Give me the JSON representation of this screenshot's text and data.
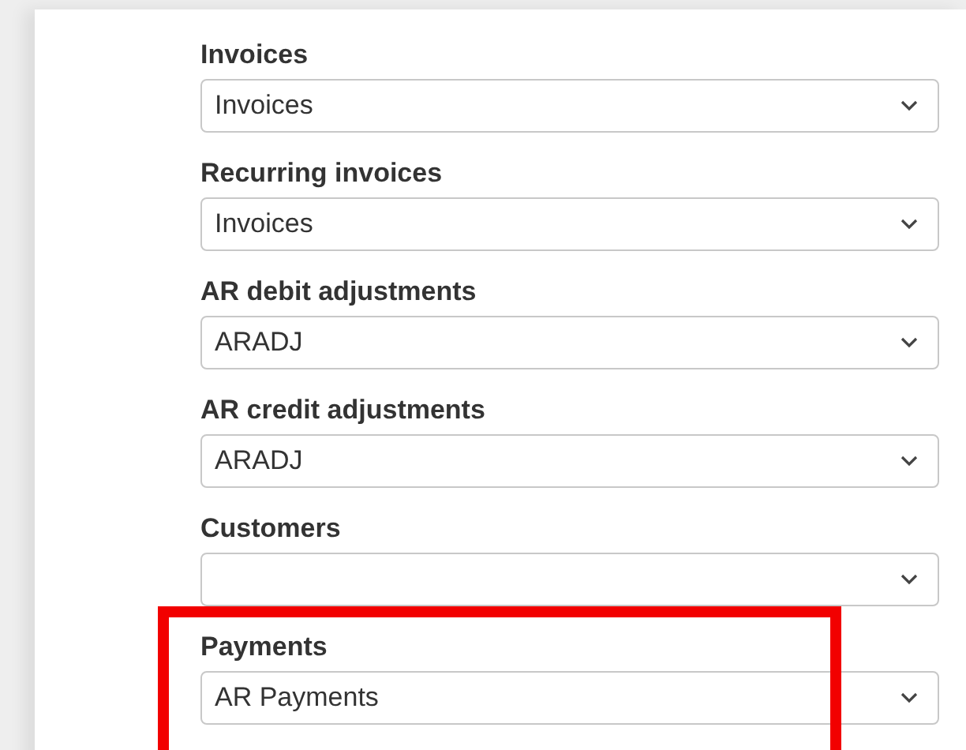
{
  "fields": [
    {
      "label": "Invoices",
      "value": "Invoices",
      "highlighted": false
    },
    {
      "label": "Recurring invoices",
      "value": "Invoices",
      "highlighted": false
    },
    {
      "label": "AR debit adjustments",
      "value": "ARADJ",
      "highlighted": false
    },
    {
      "label": "AR credit adjustments",
      "value": "ARADJ",
      "highlighted": false
    },
    {
      "label": "Customers",
      "highlighted": false
    },
    {
      "label": "Payments",
      "value": "AR Payments",
      "highlighted": true
    }
  ]
}
